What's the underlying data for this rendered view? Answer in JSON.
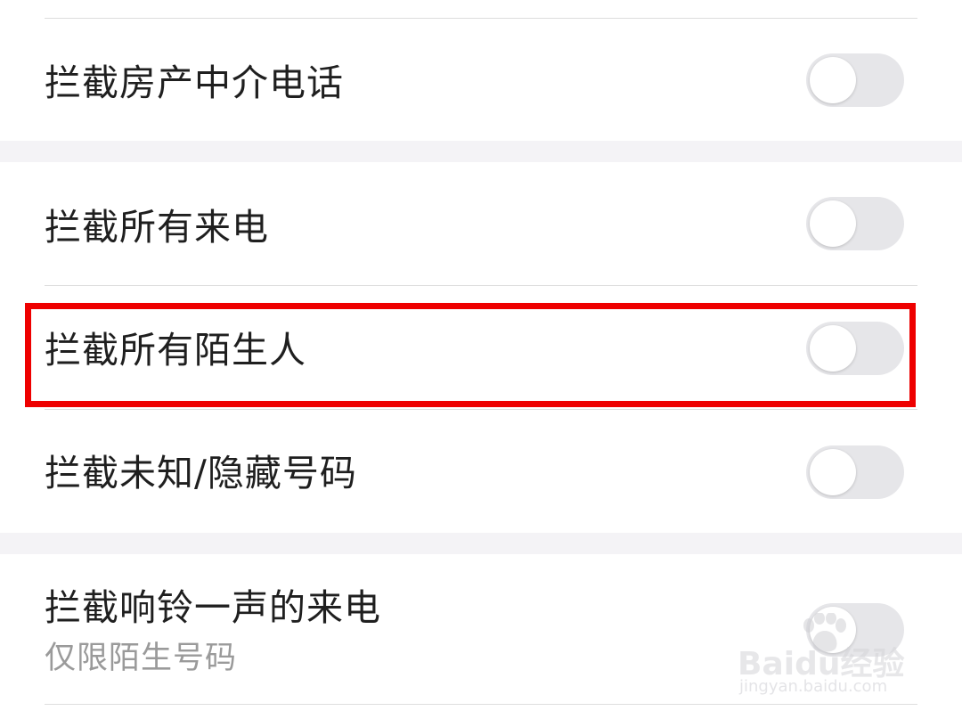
{
  "settings": {
    "items": [
      {
        "label": "拦截房产中介电话",
        "enabled": false
      },
      {
        "label": "拦截所有来电",
        "enabled": false
      },
      {
        "label": "拦截所有陌生人",
        "enabled": false,
        "highlighted": true
      },
      {
        "label": "拦截未知/隐藏号码",
        "enabled": false
      },
      {
        "label": "拦截响铃一声的来电",
        "sublabel": "仅限陌生号码",
        "enabled": false
      }
    ]
  },
  "watermark": {
    "brand": "Baidu经验",
    "url": "jingyan.baidu.com"
  },
  "colors": {
    "highlight": "#ee0000",
    "toggle_off": "#e6e6e9",
    "section_gap": "#f4f3f6"
  }
}
